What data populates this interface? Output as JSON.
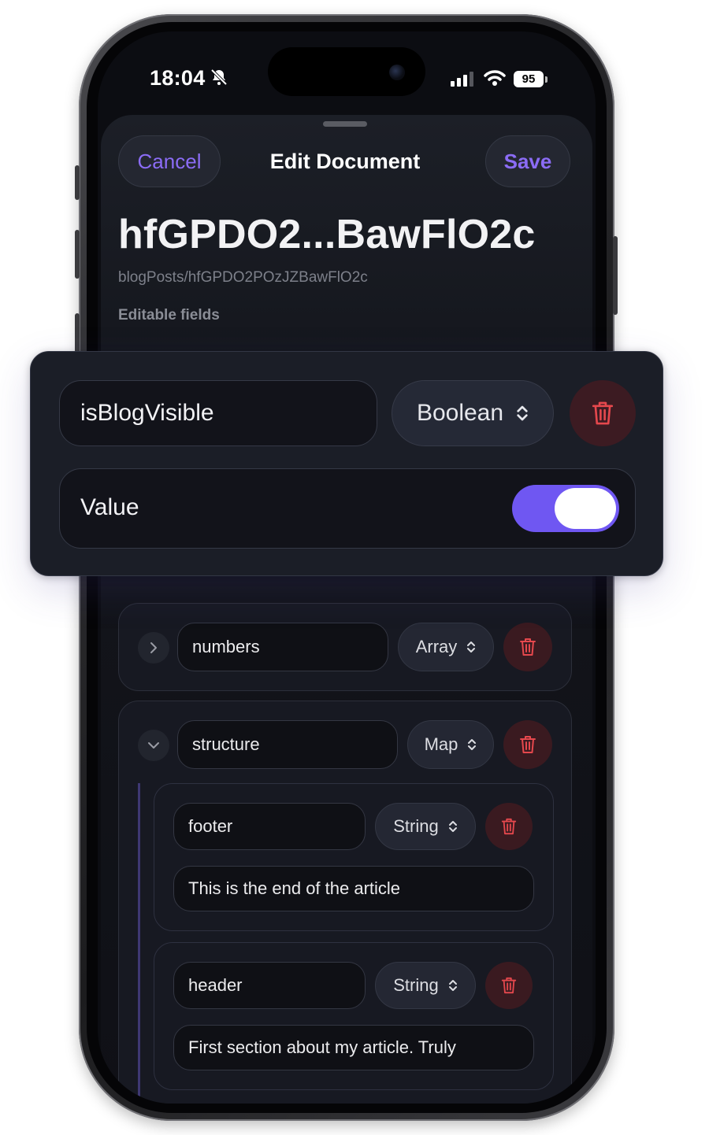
{
  "status_bar": {
    "time": "18:04",
    "battery": "95"
  },
  "nav": {
    "cancel_label": "Cancel",
    "title": "Edit Document",
    "save_label": "Save"
  },
  "document": {
    "title": "hfGPDO2...BawFlO2c",
    "path": "blogPosts/hfGPDO2POzJZBawFlO2c",
    "section_label": "Editable fields"
  },
  "focused_field": {
    "name": "isBlogVisible",
    "type": "Boolean",
    "value_label": "Value",
    "value": true
  },
  "fields": [
    {
      "name": "numbers",
      "type": "Array",
      "expanded": false
    },
    {
      "name": "structure",
      "type": "Map",
      "expanded": true,
      "children": [
        {
          "name": "footer",
          "type": "String",
          "value": "This is the end of the article"
        },
        {
          "name": "header",
          "type": "String",
          "value": "First section about my article. Truly"
        }
      ]
    }
  ],
  "colors": {
    "accent": "#6f57f2",
    "danger": "#e5484d",
    "background": "#0c0d12"
  },
  "icons": [
    "bell-slash-icon",
    "signal-icon",
    "wifi-icon",
    "chevron-right-icon",
    "chevron-down-icon",
    "updown-chevron-icon",
    "trash-icon"
  ]
}
